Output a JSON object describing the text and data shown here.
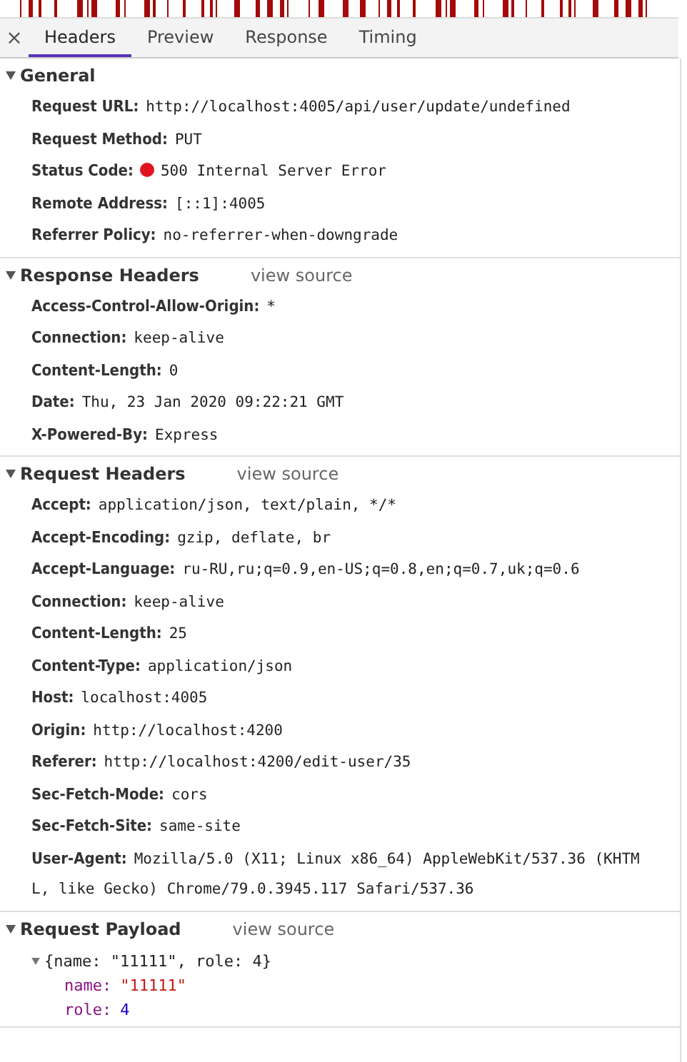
{
  "tabs": [
    {
      "label": "Headers",
      "selected": true
    },
    {
      "label": "Preview",
      "selected": false
    },
    {
      "label": "Response",
      "selected": false
    },
    {
      "label": "Timing",
      "selected": false
    }
  ],
  "close_glyph": "×",
  "sections": [
    {
      "title": "General",
      "expanded": true,
      "rows": [
        {
          "name": "Request URL:",
          "value": "http://localhost:4005/api/user/update/undefined"
        },
        {
          "name": "Request Method:",
          "value": "PUT"
        },
        {
          "name": "Status Code:",
          "value": "500 Internal Server Error",
          "color": "#e0141e"
        },
        {
          "name": "Remote Address:",
          "value": "[::1]:4005"
        },
        {
          "name": "Referrer Policy:",
          "value": "no-referrer-when-downgrade"
        }
      ]
    },
    {
      "title": "Response Headers",
      "link": "view source",
      "expanded": true,
      "rows": [
        {
          "name": "Access-Control-Allow-Origin:",
          "value": "*"
        },
        {
          "name": "Connection:",
          "value": "keep-alive"
        },
        {
          "name": "Content-Length:",
          "value": "0"
        },
        {
          "name": "Date:",
          "value": "Thu, 23 Jan 2020 09:22:21 GMT"
        },
        {
          "name": "X-Powered-By:",
          "value": "Express"
        }
      ]
    },
    {
      "title": "Request Headers",
      "link": "view source",
      "expanded": true,
      "rows": [
        {
          "name": "Accept:",
          "value": "application/json, text/plain, */*"
        },
        {
          "name": "Accept-Encoding:",
          "value": "gzip, deflate, br"
        },
        {
          "name": "Accept-Language:",
          "value": "ru-RU,ru;q=0.9,en-US;q=0.8,en;q=0.7,uk;q=0.6"
        },
        {
          "name": "Connection:",
          "value": "keep-alive"
        },
        {
          "name": "Content-Length:",
          "value": "25"
        },
        {
          "name": "Content-Type:",
          "value": "application/json"
        },
        {
          "name": "Host:",
          "value": "localhost:4005"
        },
        {
          "name": "Origin:",
          "value": "http://localhost:4200"
        },
        {
          "name": "Referer:",
          "value": "http://localhost:4200/edit-user/35"
        },
        {
          "name": "Sec-Fetch-Mode:",
          "value": "cors"
        },
        {
          "name": "Sec-Fetch-Site:",
          "value": "same-site"
        },
        {
          "name": "User-Agent:",
          "value": "Mozilla/5.0 (X11; Linux x86_64) AppleWebKit/537.36 (KHTM",
          "continuation": "L, like Gecko) Chrome/79.0.3945.117 Safari/537.36"
        }
      ]
    },
    {
      "title": "Request Payload",
      "link": "view source",
      "expanded": true,
      "payload": {
        "summary": "{name: \"11111\", role: 4}",
        "expanded": true,
        "children": [
          {
            "key": "name:",
            "value": "\"11111\"",
            "kind": "string"
          },
          {
            "key": "role:",
            "value": "4",
            "kind": "number"
          }
        ]
      }
    }
  ]
}
